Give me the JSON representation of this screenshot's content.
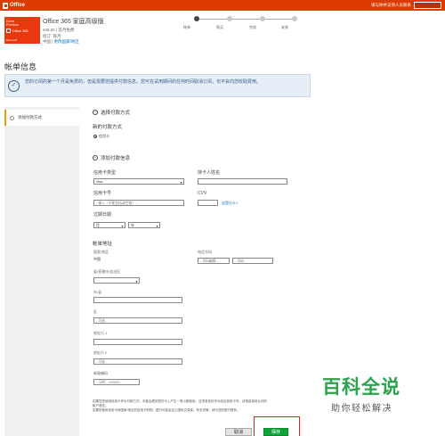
{
  "header": {
    "brand": "Office",
    "signin_link": "请与你并支持人员联系",
    "user_button": ""
  },
  "product": {
    "tile_line1": "Home",
    "tile_line2": "Premium",
    "tile_office": "Office 365",
    "tile_ms": "Microsoft",
    "name": "Office 365 家庭高级版",
    "price": "¥49.00 | 首月免费",
    "billing": "续订: 每月",
    "country": "中国",
    "change_country": "更改国家/地区"
  },
  "steps": [
    {
      "label": "帐单"
    },
    {
      "label": "购买"
    },
    {
      "label": "完成"
    },
    {
      "label": "安装"
    }
  ],
  "page_title": "帐单信息",
  "notice": {
    "text": "您的订阅的第一个月是免费的，但是需要您提供付款信息。您可在试用期间的任何时间取消订阅，也不会向您收取费用。"
  },
  "sidebar": {
    "item_label": "添加付款方式"
  },
  "payment": {
    "section1_title": "选择付款方式",
    "new_method_title": "新的付款方式",
    "radio_label": "信用卡",
    "section2_title": "添加付款信息",
    "card_type_label": "信用卡类型",
    "card_type_value": "Visa",
    "holder_label": "持卡人姓名",
    "card_no_label": "信用卡号",
    "card_no_placeholder": "- 输入（不能包括或空格）-",
    "cvv_label": "CVV",
    "cvv_link": "这是什么?",
    "expiry_label": "过期日期",
    "month_value": "月",
    "year_value": "年"
  },
  "address": {
    "title": "帐单地址",
    "country_label": "国家/地区",
    "country_value": "中国",
    "phone_label": "电话号码",
    "phone_area_placeholder": "- 号码编辑 -",
    "phone_num_placeholder": "- 号码 -",
    "province_label": "省/直辖市/自治区",
    "city_label": "市/县",
    "district_label": "区",
    "district_placeholder": "- 可选 -",
    "line1_label": "地址行 1",
    "line2_label": "地址行 2",
    "line2_placeholder": "- 可选 -",
    "postal_label": "邮政编码",
    "postal_placeholder": "- 示例：200000 -"
  },
  "fine_print": {
    "line1": "如果您您使用信用卡作为付款方式，可能会看到您的卡上产生一笔小额费用，这项费用仅作为验证信用卡号，该笔费用将从你的",
    "line2": "帐户退还。",
    "line3": "如果您使用信用卡转国家/地区的信用卡购物，银行可能会加上国际交易费，有关详情，请与您的银行联系。"
  },
  "buttons": {
    "cancel": "取消",
    "save": "保存"
  },
  "watermark": {
    "big": "百科全说",
    "small": "助你轻松解决"
  }
}
